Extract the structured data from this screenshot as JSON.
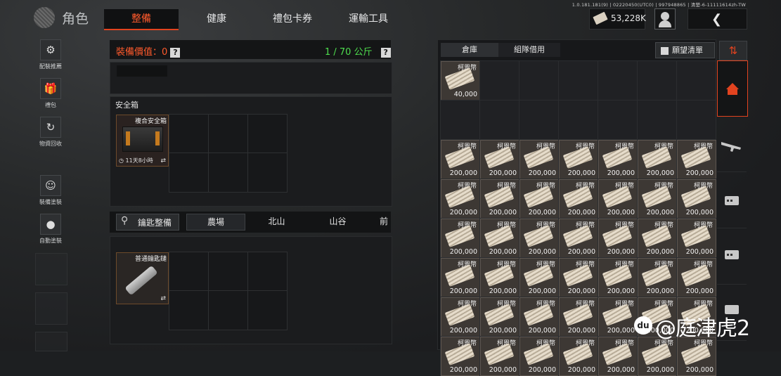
{
  "header": {
    "logo_text": "角色",
    "tabs": [
      {
        "label": "整備",
        "active": true
      },
      {
        "label": "健康",
        "active": false
      },
      {
        "label": "禮包卡券",
        "active": false
      },
      {
        "label": "運輸工具",
        "active": false
      }
    ],
    "build_info": "1.0.181.181(9) | 02220450(UTC0) | 997948865 | 清楚-6-11111614zh-TW",
    "money": "53,228K"
  },
  "left_nav": [
    {
      "label": "配裝推薦",
      "icon": "loadout-icon"
    },
    {
      "label": "禮包",
      "icon": "gift-icon"
    },
    {
      "label": "物資回收",
      "icon": "recycle-icon"
    },
    {
      "label": "裝備塗裝",
      "icon": "skin-icon"
    },
    {
      "label": "自動塗裝",
      "icon": "toggle-icon"
    }
  ],
  "equipment": {
    "value_label": "裝備價值：0",
    "weight": "1 / 70 公斤",
    "help": "?"
  },
  "safe_box": {
    "title": "安全箱",
    "item_name": "複合安全箱",
    "timer": "11天8小時"
  },
  "keys": {
    "button_label": "鑰匙整備",
    "locations": [
      "農場",
      "北山",
      "山谷",
      "前"
    ],
    "item_name": "普通鑰匙鏈"
  },
  "warehouse": {
    "tabs": [
      {
        "label": "倉庫",
        "active": true
      },
      {
        "label": "組隊借用",
        "active": false
      }
    ],
    "wishlist_label": "願望清單",
    "sort_icon": "sort-icon",
    "first_item": {
      "name": "柯恩幣",
      "value": "40,000"
    },
    "item_name": "柯恩幣",
    "item_value": "200,000"
  },
  "right_sidebar": [
    "home-icon",
    "rifle-icon",
    "ammo-box-icon",
    "ammo-box-icon",
    "ammo-box-icon"
  ],
  "watermark": "@庭津虎2",
  "colors": {
    "accent": "#e2431f",
    "weight_green": "#4ede4e"
  }
}
